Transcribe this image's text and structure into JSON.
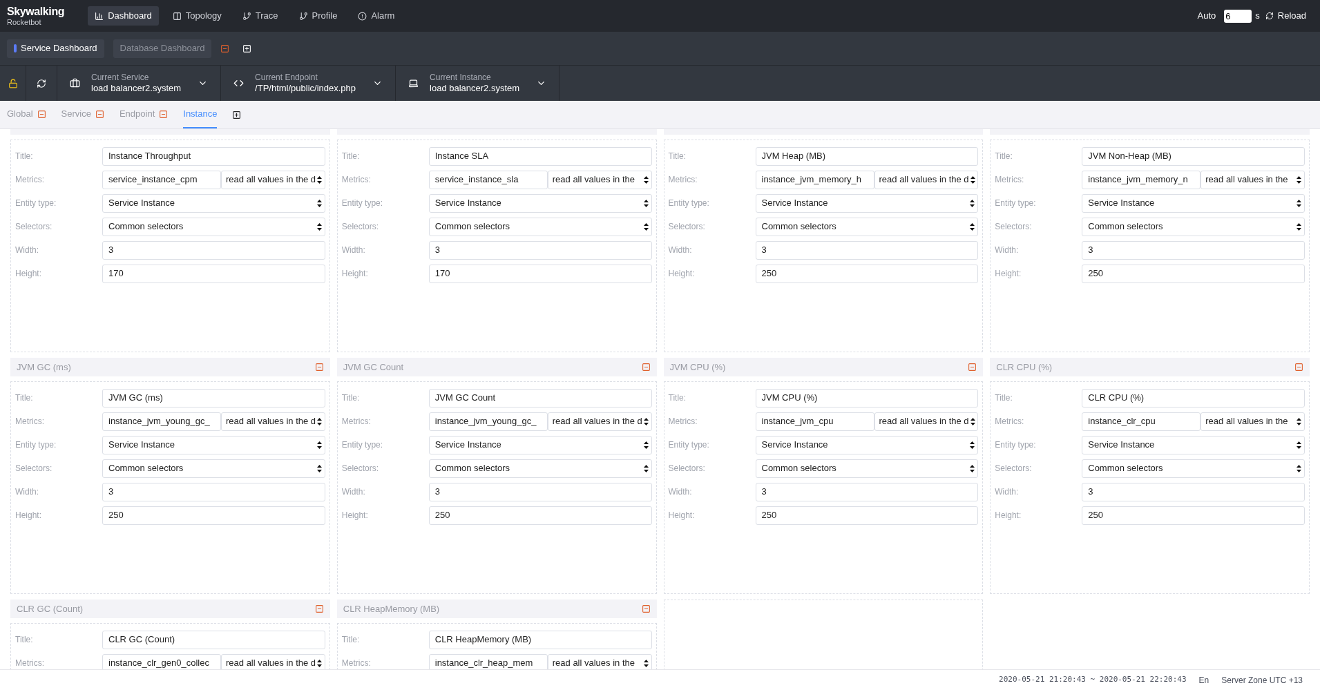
{
  "brand": {
    "name": "Skywalking",
    "subtitle": "Rocketbot"
  },
  "nav": [
    {
      "label": "Dashboard",
      "kind": "chart",
      "selected": true
    },
    {
      "label": "Topology",
      "kind": "topology",
      "selected": false
    },
    {
      "label": "Trace",
      "kind": "branch",
      "selected": false
    },
    {
      "label": "Profile",
      "kind": "branch",
      "selected": false
    },
    {
      "label": "Alarm",
      "kind": "alert",
      "selected": false
    }
  ],
  "auto_refresh": {
    "label": "Auto",
    "value": "6",
    "unit": "s",
    "reload": "Reload"
  },
  "dashboards": [
    {
      "label": "Service Dashboard",
      "selected": true
    },
    {
      "label": "Database Dashboard",
      "selected": false
    }
  ],
  "selectors": [
    {
      "label": "Current Service",
      "value": "load balancer2.system",
      "kind": "service"
    },
    {
      "label": "Current Endpoint",
      "value": "/TP/html/public/index.php",
      "kind": "code"
    },
    {
      "label": "Current Instance",
      "value": "load balancer2.system",
      "kind": "instance"
    }
  ],
  "tabs": [
    {
      "label": "Global",
      "removable": true,
      "selected": false
    },
    {
      "label": "Service",
      "removable": true,
      "selected": false
    },
    {
      "label": "Endpoint",
      "removable": true,
      "selected": false
    },
    {
      "label": "Instance",
      "removable": false,
      "selected": true
    }
  ],
  "cards": [
    {
      "fields": [
        {
          "kind": "input",
          "label": "Title:",
          "value": "Instance Throughput"
        },
        {
          "kind": "metric",
          "label": "Metrics:",
          "value": "service_instance_cpm",
          "aggregation": "read all values in the d"
        },
        {
          "kind": "select",
          "label": "Entity type:",
          "value": "Service Instance"
        },
        {
          "kind": "select",
          "label": "Selectors:",
          "value": "Common selectors"
        },
        {
          "kind": "input",
          "label": "Width:",
          "value": "3"
        },
        {
          "kind": "input",
          "label": "Height:",
          "value": "170"
        }
      ]
    },
    {
      "fields": [
        {
          "kind": "input",
          "label": "Title:",
          "value": "Instance SLA"
        },
        {
          "kind": "metric",
          "label": "Metrics:",
          "value": "service_instance_sla",
          "aggregation": "read all values in the"
        },
        {
          "kind": "select",
          "label": "Entity type:",
          "value": "Service Instance"
        },
        {
          "kind": "select",
          "label": "Selectors:",
          "value": "Common selectors"
        },
        {
          "kind": "input",
          "label": "Width:",
          "value": "3"
        },
        {
          "kind": "input",
          "label": "Height:",
          "value": "170"
        }
      ]
    },
    {
      "fields": [
        {
          "kind": "input",
          "label": "Title:",
          "value": "JVM Heap (MB)"
        },
        {
          "kind": "metric",
          "label": "Metrics:",
          "value": "instance_jvm_memory_h",
          "aggregation": "read all values in the d"
        },
        {
          "kind": "select",
          "label": "Entity type:",
          "value": "Service Instance"
        },
        {
          "kind": "select",
          "label": "Selectors:",
          "value": "Common selectors"
        },
        {
          "kind": "input",
          "label": "Width:",
          "value": "3"
        },
        {
          "kind": "input",
          "label": "Height:",
          "value": "250"
        }
      ]
    },
    {
      "fields": [
        {
          "kind": "input",
          "label": "Title:",
          "value": "JVM Non-Heap (MB)"
        },
        {
          "kind": "metric",
          "label": "Metrics:",
          "value": "instance_jvm_memory_n",
          "aggregation": "read all values in the"
        },
        {
          "kind": "select",
          "label": "Entity type:",
          "value": "Service Instance"
        },
        {
          "kind": "select",
          "label": "Selectors:",
          "value": "Common selectors"
        },
        {
          "kind": "input",
          "label": "Width:",
          "value": "3"
        },
        {
          "kind": "input",
          "label": "Height:",
          "value": "250"
        }
      ]
    },
    {
      "header": "JVM GC (ms)",
      "fields": [
        {
          "kind": "input",
          "label": "Title:",
          "value": "JVM GC (ms)"
        },
        {
          "kind": "metric",
          "label": "Metrics:",
          "value": "instance_jvm_young_gc_",
          "aggregation": "read all values in the d"
        },
        {
          "kind": "select",
          "label": "Entity type:",
          "value": "Service Instance"
        },
        {
          "kind": "select",
          "label": "Selectors:",
          "value": "Common selectors"
        },
        {
          "kind": "input",
          "label": "Width:",
          "value": "3"
        },
        {
          "kind": "input",
          "label": "Height:",
          "value": "250"
        }
      ]
    },
    {
      "header": "JVM GC Count",
      "fields": [
        {
          "kind": "input",
          "label": "Title:",
          "value": "JVM GC Count"
        },
        {
          "kind": "metric",
          "label": "Metrics:",
          "value": "instance_jvm_young_gc_",
          "aggregation": "read all values in the d"
        },
        {
          "kind": "select",
          "label": "Entity type:",
          "value": "Service Instance"
        },
        {
          "kind": "select",
          "label": "Selectors:",
          "value": "Common selectors"
        },
        {
          "kind": "input",
          "label": "Width:",
          "value": "3"
        },
        {
          "kind": "input",
          "label": "Height:",
          "value": "250"
        }
      ]
    },
    {
      "header": "JVM CPU (%)",
      "fields": [
        {
          "kind": "input",
          "label": "Title:",
          "value": "JVM CPU (%)"
        },
        {
          "kind": "metric",
          "label": "Metrics:",
          "value": "instance_jvm_cpu",
          "aggregation": "read all values in the d"
        },
        {
          "kind": "select",
          "label": "Entity type:",
          "value": "Service Instance"
        },
        {
          "kind": "select",
          "label": "Selectors:",
          "value": "Common selectors"
        },
        {
          "kind": "input",
          "label": "Width:",
          "value": "3"
        },
        {
          "kind": "input",
          "label": "Height:",
          "value": "250"
        }
      ]
    },
    {
      "header": "CLR CPU (%)",
      "fields": [
        {
          "kind": "input",
          "label": "Title:",
          "value": "CLR CPU (%)"
        },
        {
          "kind": "metric",
          "label": "Metrics:",
          "value": "instance_clr_cpu",
          "aggregation": "read all values in the"
        },
        {
          "kind": "select",
          "label": "Entity type:",
          "value": "Service Instance"
        },
        {
          "kind": "select",
          "label": "Selectors:",
          "value": "Common selectors"
        },
        {
          "kind": "input",
          "label": "Width:",
          "value": "3"
        },
        {
          "kind": "input",
          "label": "Height:",
          "value": "250"
        }
      ]
    },
    {
      "header": "CLR GC (Count)",
      "fields": [
        {
          "kind": "input",
          "label": "Title:",
          "value": "CLR GC (Count)"
        },
        {
          "kind": "metric",
          "label": "Metrics:",
          "value": "instance_clr_gen0_collec",
          "aggregation": "read all values in the d"
        }
      ]
    },
    {
      "header": "CLR HeapMemory (MB)",
      "fields": [
        {
          "kind": "input",
          "label": "Title:",
          "value": "CLR HeapMemory (MB)"
        },
        {
          "kind": "metric",
          "label": "Metrics:",
          "value": "instance_clr_heap_mem",
          "aggregation": "read all values in the"
        }
      ]
    },
    {
      "kind": "placeholder"
    }
  ],
  "footer": {
    "time_range": "2020-05-21 21:20:43 ~ 2020-05-21 22:20:43",
    "language": "En",
    "server_zone": "Server Zone UTC +13"
  }
}
